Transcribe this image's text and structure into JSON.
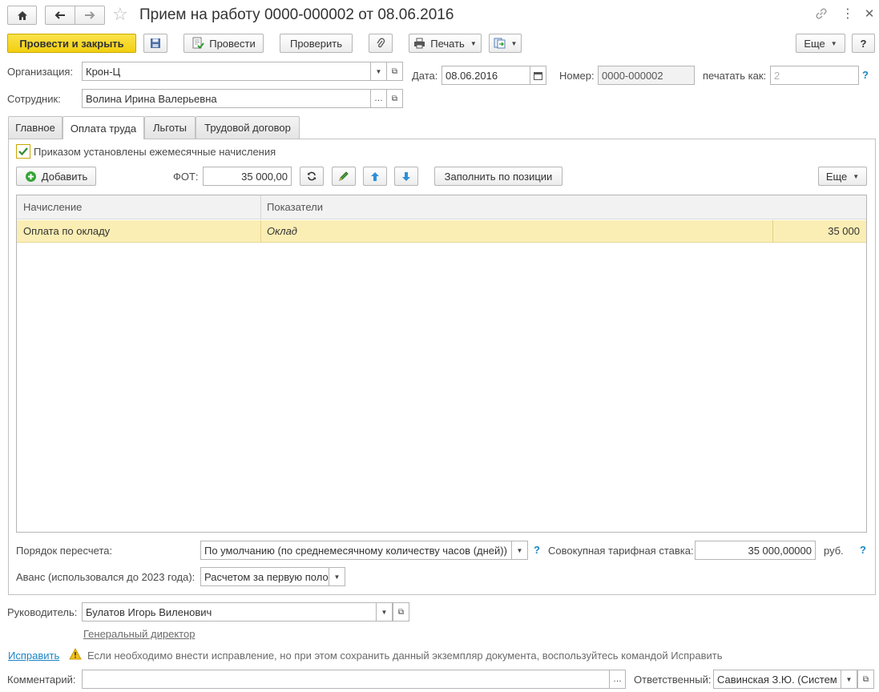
{
  "window": {
    "title": "Прием на работу 0000-000002 от 08.06.2016"
  },
  "toolbar": {
    "post_close": "Провести и закрыть",
    "post": "Провести",
    "check": "Проверить",
    "print": "Печать",
    "more": "Еще",
    "help": "?"
  },
  "header": {
    "org_label": "Организация:",
    "org_value": "Крон-Ц",
    "date_label": "Дата:",
    "date_value": "08.06.2016",
    "number_label": "Номер:",
    "number_value": "0000-000002",
    "print_as_label": "печатать как:",
    "print_as_placeholder": "2",
    "employee_label": "Сотрудник:",
    "employee_value": "Волина Ирина Валерьевна"
  },
  "tabs": [
    {
      "label": "Главное"
    },
    {
      "label": "Оплата труда"
    },
    {
      "label": "Льготы"
    },
    {
      "label": "Трудовой договор"
    }
  ],
  "payment": {
    "checkbox_label": "Приказом установлены ежемесячные начисления",
    "checkbox_checked": true,
    "add_label": "Добавить",
    "fot_label": "ФОТ:",
    "fot_value": "35 000,00",
    "fill_by_position": "Заполнить по позиции",
    "more": "Еще",
    "columns": [
      "Начисление",
      "Показатели"
    ],
    "rows": [
      {
        "accrual": "Оплата по окладу",
        "indicator": "Оклад",
        "value": "35 000"
      }
    ],
    "recalc_label": "Порядок пересчета:",
    "recalc_value": "По умолчанию (по среднемесячному количеству часов (дней))",
    "total_rate_label": "Совокупная тарифная ставка:",
    "total_rate_value": "35 000,00000",
    "currency": "руб.",
    "advance_label": "Аванс (использовался до 2023 года):",
    "advance_value": "Расчетом за первую поло"
  },
  "footer": {
    "manager_label": "Руководитель:",
    "manager_value": "Булатов Игорь Виленович",
    "manager_position": "Генеральный директор",
    "fix_link": "Исправить",
    "warning_text": "Если необходимо внести исправление, но при этом сохранить данный экземпляр документа, воспользуйтесь командой Исправить",
    "comment_label": "Комментарий:",
    "comment_value": "",
    "responsible_label": "Ответственный:",
    "responsible_value": "Савинская З.Ю. (Систем"
  },
  "colors": {
    "primary_button": "#f5d51b",
    "selected_row": "#fbeeb4",
    "link": "#1c86c6",
    "help": "#1c86c6"
  }
}
